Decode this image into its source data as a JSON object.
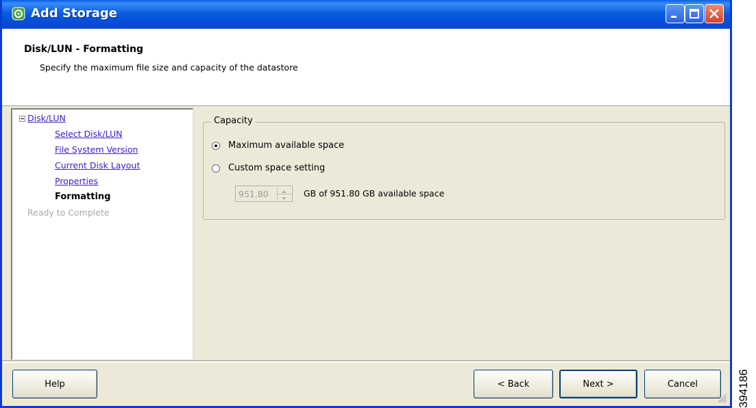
{
  "window": {
    "title": "Add Storage",
    "icons": {
      "app": "storage-icon",
      "minimize": "minimize-icon",
      "maximize": "maximize-icon",
      "close": "close-icon"
    },
    "accent_color": "#0a5fe8"
  },
  "header": {
    "title": "Disk/LUN - Formatting",
    "subtitle": "Specify the maximum file size and capacity of the datastore"
  },
  "nav": {
    "group": "Disk/LUN",
    "items": [
      {
        "label": "Select Disk/LUN",
        "state": "link"
      },
      {
        "label": "File System Version",
        "state": "link"
      },
      {
        "label": "Current Disk Layout",
        "state": "link"
      },
      {
        "label": "Properties",
        "state": "link"
      },
      {
        "label": "Formatting",
        "state": "current"
      }
    ],
    "after": {
      "label": "Ready to Complete",
      "state": "disabled"
    }
  },
  "capacity": {
    "legend": "Capacity",
    "option_max": "Maximum available space",
    "option_custom": "Custom space setting",
    "selected": "option_max",
    "custom_value": "951.80",
    "available_text": "GB of 951.80 GB available space"
  },
  "buttons": {
    "help": "Help",
    "back": "< Back",
    "next": "Next >",
    "cancel": "Cancel"
  },
  "figure_id": "394186"
}
